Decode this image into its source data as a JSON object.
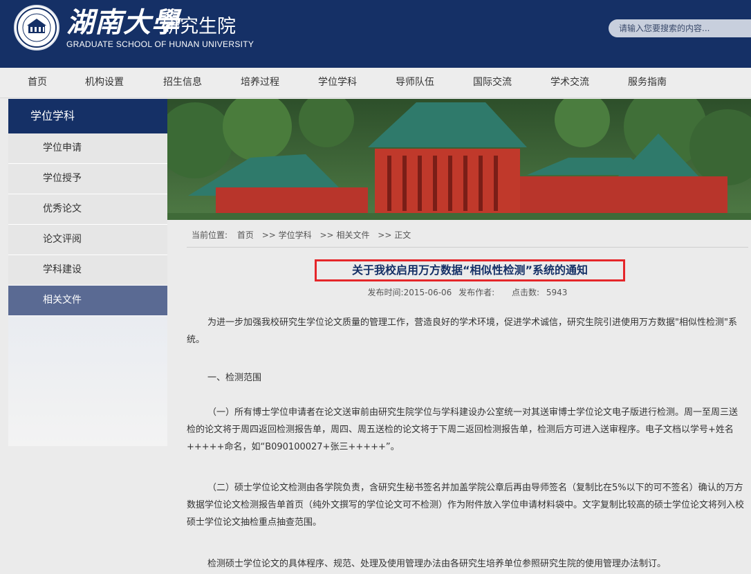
{
  "header": {
    "school_name_cn": "湖南大學",
    "school_sub": "研究生院",
    "school_name_en": "GRADUATE SCHOOL OF HUNAN UNIVERSITY",
    "search_placeholder": "请输入您要搜索的内容..."
  },
  "nav": {
    "items": [
      "首页",
      "机构设置",
      "招生信息",
      "培养过程",
      "学位学科",
      "导师队伍",
      "国际交流",
      "学术交流",
      "服务指南"
    ]
  },
  "sidebar": {
    "title": "学位学科",
    "items": [
      {
        "label": "学位申请"
      },
      {
        "label": "学位授予"
      },
      {
        "label": "优秀论文"
      },
      {
        "label": "论文评阅"
      },
      {
        "label": "学科建设"
      },
      {
        "label": "相关文件",
        "active": true
      }
    ]
  },
  "breadcrumb": {
    "prefix": "当前位置:",
    "items": [
      "首页",
      "学位学科",
      "相关文件",
      "正文"
    ],
    "separator": ">>"
  },
  "article": {
    "title": "关于我校启用万方数据“相似性检测”系统的通知",
    "publish_label": "发布时间:",
    "publish_date": "2015-06-06",
    "author_label": "发布作者:",
    "author": "",
    "views_label": "点击数:",
    "views": "5943",
    "paragraphs": [
      "为进一步加强我校研究生学位论文质量的管理工作，营造良好的学术环境，促进学术诚信，研究生院引进使用万方数据\"相似性检测\"系统。",
      "一、检测范围",
      "（一）所有博士学位申请者在论文送审前由研究生院学位与学科建设办公室统一对其送审博士学位论文电子版进行检测。周一至周三送检的论文将于周四返回检测报告单，周四、周五送检的论文将于下周二返回检测报告单，检测后方可进入送审程序。电子文档以学号+姓名+++++命名，如“B090100027+张三+++++”。",
      "（二）硕士学位论文检测由各学院负责，含研究生秘书签名并加盖学院公章后再由导师签名（复制比在5%以下的可不签名）确认的万方数据学位论文检测报告单首页（纯外文撰写的学位论文可不检测）作为附件放入学位申请材料袋中。文字复制比较高的硕士学位论文将列入校硕士学位论文抽检重点抽查范围。",
      "检测硕士学位论文的具体程序、规范、处理及使用管理办法由各研究生培养单位参照研究生院的使用管理办法制订。"
    ]
  },
  "colors": {
    "brand_navy": "#153066",
    "highlight_red": "#e5262a",
    "sidebar_active": "#5a6a93"
  }
}
